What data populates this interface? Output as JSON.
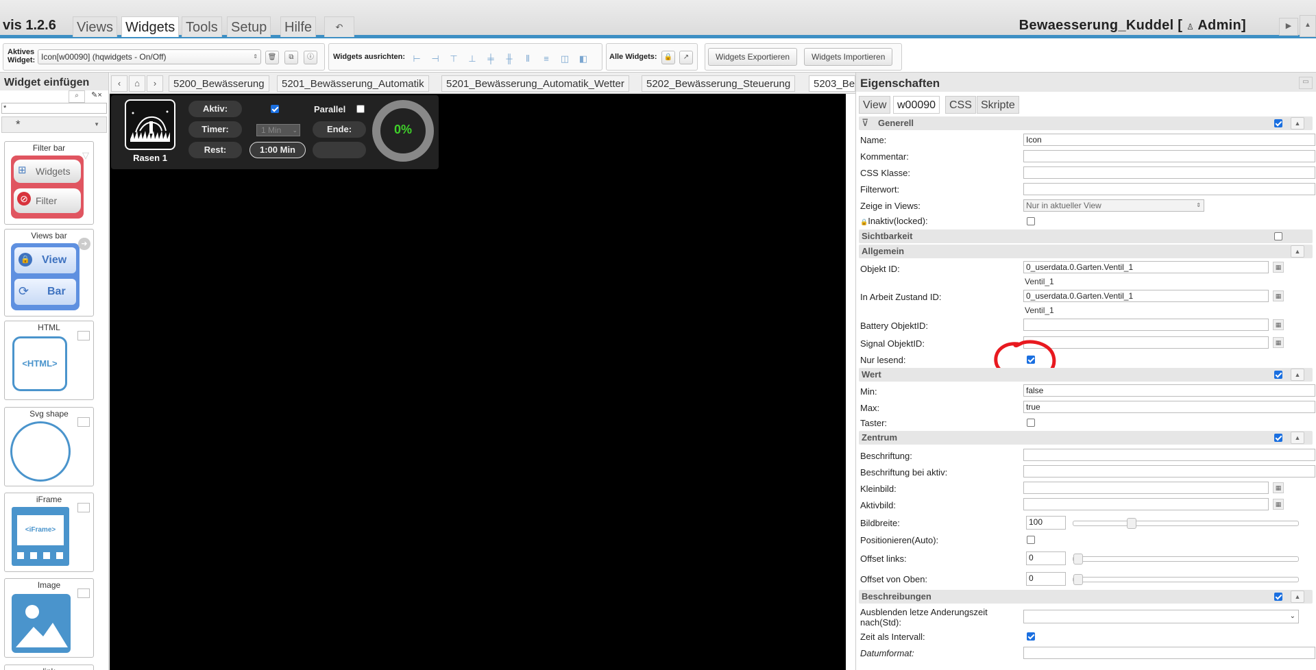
{
  "app": {
    "title": "vis 1.2.6",
    "project": "Bewaesserung_Kuddel [",
    "user_icon": "user-icon",
    "user": "Admin]"
  },
  "menu": [
    {
      "label": "Views"
    },
    {
      "label": "Widgets"
    },
    {
      "label": "Tools"
    },
    {
      "label": "Setup"
    },
    {
      "label": "Hilfe"
    }
  ],
  "toolbar": {
    "active_widget_label_1": "Aktives",
    "active_widget_label_2": "Widget:",
    "active_widget_value": "Icon[w00090] (hqwidgets - On/Off)",
    "align_label": "Widgets ausrichten:",
    "all_widgets_label": "Alle Widgets:",
    "export_label": "Widgets Exportieren",
    "import_label": "Widgets Importieren"
  },
  "left_panel": {
    "title": "Widget einfügen",
    "filter_value": "*",
    "set_value": "*",
    "cards": [
      {
        "caption": "Filter bar",
        "btn1": "Widgets",
        "btn2": "Filter"
      },
      {
        "caption": "Views bar",
        "btn1": "View",
        "btn2": "Bar"
      },
      {
        "caption": "HTML",
        "text": "<HTML>"
      },
      {
        "caption": "Svg shape"
      },
      {
        "caption": "iFrame",
        "text": "<iFrame>"
      },
      {
        "caption": "Image"
      },
      {
        "caption": "link"
      }
    ]
  },
  "view_tabs": [
    "5200_Bewässerung",
    "5201_Bewässerung_Automatik",
    "5201_Bewässerung_Automatik_Wetter",
    "5202_Bewässerung_Steuerung",
    "5203_Be"
  ],
  "widget": {
    "name": "Rasen 1",
    "aktiv_label": "Aktiv:",
    "aktiv_checked": true,
    "parallel_label": "Parallel",
    "parallel_checked": false,
    "timer_label": "Timer:",
    "timer_value": "1 Min",
    "ende_label": "Ende:",
    "rest_label": "Rest:",
    "rest_value": "1:00 Min",
    "progress_text": "0%",
    "progress_value": 0
  },
  "properties": {
    "title": "Eigenschaften",
    "tabs": [
      "View",
      "w00090",
      "CSS",
      "Skripte"
    ],
    "sections": {
      "generell": "Generell",
      "sichtbarkeit": "Sichtbarkeit",
      "allgemein": "Allgemein",
      "wert": "Wert",
      "zentrum": "Zentrum",
      "beschreibungen": "Beschreibungen"
    },
    "name_label": "Name:",
    "name_value": "Icon",
    "kommentar_label": "Kommentar:",
    "css_klasse_label": "CSS Klasse:",
    "filterwort_label": "Filterwort:",
    "zeige_label": "Zeige in Views:",
    "zeige_value": "Nur in aktueller View",
    "inaktiv_label": "Inaktiv(locked):",
    "objekt_id_label": "Objekt ID:",
    "objekt_id_value": "0_userdata.0.Garten.Ventil_1",
    "objekt_id_hint": "Ventil_1",
    "inarbeit_label": "In Arbeit Zustand ID:",
    "inarbeit_value": "0_userdata.0.Garten.Ventil_1",
    "inarbeit_hint": "Ventil_1",
    "battery_label": "Battery ObjektID:",
    "signal_label": "Signal ObjektID:",
    "nur_lesend_label": "Nur lesend:",
    "min_label": "Min:",
    "min_value": "false",
    "max_label": "Max:",
    "max_value": "true",
    "taster_label": "Taster:",
    "beschriftung_label": "Beschriftung:",
    "beschriftung_aktiv_label": "Beschriftung bei aktiv:",
    "kleinbild_label": "Kleinbild:",
    "aktivbild_label": "Aktivbild:",
    "bildbreite_label": "Bildbreite:",
    "bildbreite_value": "100",
    "positionieren_label": "Positionieren(Auto):",
    "offset_links_label": "Offset links:",
    "offset_links_value": "0",
    "offset_oben_label": "Offset von Oben:",
    "offset_oben_value": "0",
    "ausblenden_label_1": "Ausblenden letze Anderungszeit",
    "ausblenden_label_2": "nach(Std):",
    "zeit_intervall_label": "Zeit als Intervall:",
    "datumformat_label": "Datumformat:"
  },
  "annotation_color": "#e8191f"
}
